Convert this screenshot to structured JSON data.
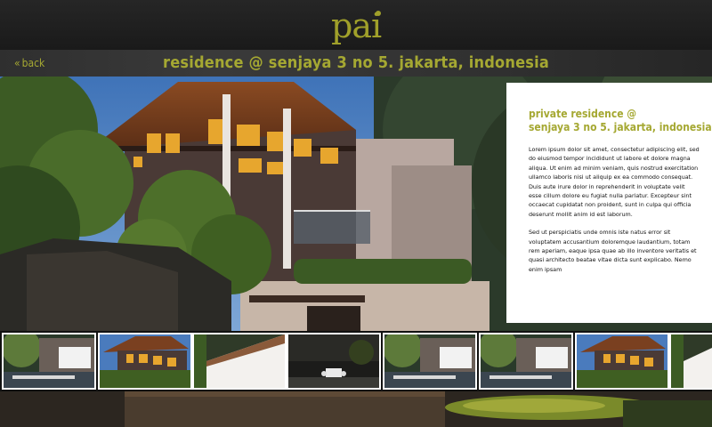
{
  "brand": {
    "logo_text": "pai",
    "accent": "#a5a832"
  },
  "nav": {
    "back_label": "back",
    "back_icon": "double-chevron-left-icon"
  },
  "page": {
    "title": "residence @ senjaya 3 no 5. jakarta, indonesia"
  },
  "info": {
    "heading_line1": "private residence @",
    "heading_line2": "senjaya 3 no 5. jakarta, indonesia",
    "paragraph1": "Lorem ipsum dolor sit amet, consectetur adipiscing elit, sed do eiusmod tempor incididunt ut labore et dolore magna aliqua. Ut enim ad minim veniam, quis nostrud exercitation ullamco laboris nisi ut aliquip ex ea commodo consequat. Duis aute irure dolor in reprehenderit in voluptate velit esse cillum dolore eu fugiat nulla pariatur. Excepteur sint occaecat cupidatat non proident, sunt in culpa qui officia deserunt mollit anim id est laborum.",
    "paragraph2": "Sed ut perspiciatis unde omnis iste natus error sit voluptatem accusantium doloremque laudantium, totam rem aperiam, eaque ipsa quae ab illo inventore veritatis et quasi architecto beatae vitae dicta sunt explicabo. Nemo enim ipsam"
  },
  "thumbnails": [
    {
      "scene": "pool-house"
    },
    {
      "scene": "residence-dusk"
    },
    {
      "scene": "white-wall"
    },
    {
      "scene": "garden-dining"
    },
    {
      "scene": "pool-house"
    },
    {
      "scene": "pool-house"
    },
    {
      "scene": "residence-dusk"
    },
    {
      "scene": "white-wall"
    }
  ]
}
